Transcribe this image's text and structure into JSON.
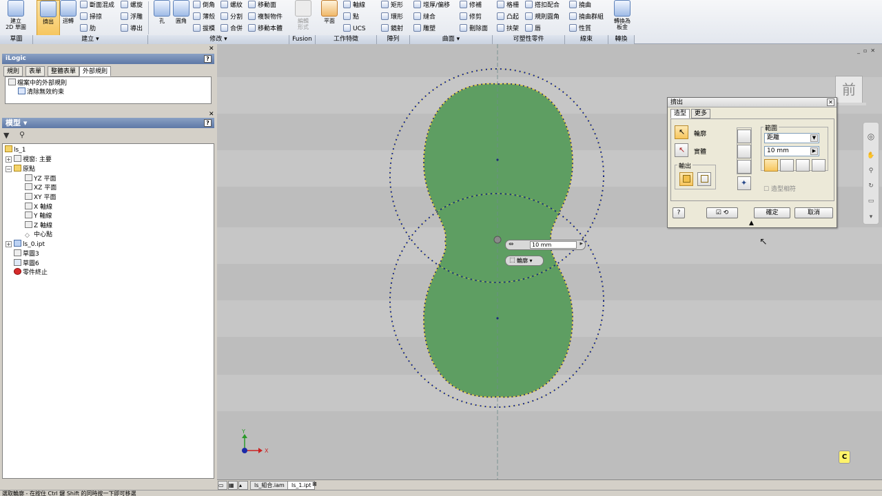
{
  "ribbon": {
    "sketch": {
      "create_2d_sketch": "建立\n2D 草圖",
      "group": "草圖"
    },
    "create": {
      "extrude": "擠出",
      "revolve": "迴轉",
      "loft": "斷面混成",
      "sweep": "掃掠",
      "rib": "肋",
      "coil": "螺旋",
      "emboss": "浮雕",
      "derive": "導出",
      "group": "建立 ▾"
    },
    "modify": {
      "hole": "孔",
      "fillet": "圓角",
      "chamfer": "倒角",
      "shell": "薄殼",
      "draft": "拔模",
      "thread": "螺紋",
      "split": "分割",
      "combine": "合併",
      "move_face": "移動面",
      "copy_object": "複製物件",
      "move_bodies": "移動本體",
      "group": "修改 ▾"
    },
    "fusion": {
      "edit_form": "編輯\n形式",
      "group": "Fusion"
    },
    "work_features": {
      "plane": "平面",
      "axis": "軸線",
      "point": "點",
      "ucs": "UCS",
      "group": "工作特徵"
    },
    "pattern": {
      "rectangular": "矩形",
      "circular": "環形",
      "mirror": "鏡射",
      "group": "陣列"
    },
    "surface": {
      "thicken": "增厚/偏移",
      "stitch": "縫合",
      "sculpt": "雕塑",
      "patch": "修補",
      "trim": "修剪",
      "delete_face": "刪除面",
      "group": "曲面 ▾"
    },
    "plastic_part": {
      "grill": "格柵",
      "boss": "凸起",
      "rest": "扶架",
      "snap_fit": "搭扣配合",
      "rule_fillet": "規則圓角",
      "lip": "唇",
      "group": "可塑性零件"
    },
    "harness": {
      "bend": "撓曲",
      "bend_part": "撓曲群組",
      "property": "性質",
      "group": "線束"
    },
    "convert": {
      "sheet_metal": "轉換為\n板金",
      "group": "轉換"
    }
  },
  "ilogic": {
    "title": "iLogic",
    "help": "?",
    "tabs": [
      "規則",
      "表單",
      "整體表單",
      "外部規則"
    ],
    "active_tab": 3,
    "items": [
      "檔案中的外部規則",
      "清除無效約束"
    ]
  },
  "model": {
    "title": "模型 ▾",
    "help": "?",
    "tree": [
      {
        "label": "ls_1",
        "level": 0
      },
      {
        "label": "視窗: 主要",
        "level": 1
      },
      {
        "label": "原點",
        "level": 1
      },
      {
        "label": "YZ 平面",
        "level": 2
      },
      {
        "label": "XZ 平面",
        "level": 2
      },
      {
        "label": "XY 平面",
        "level": 2
      },
      {
        "label": "X 軸線",
        "level": 2
      },
      {
        "label": "Y 軸線",
        "level": 2
      },
      {
        "label": "Z 軸線",
        "level": 2
      },
      {
        "label": "中心點",
        "level": 2
      },
      {
        "label": "ls_0.ipt",
        "level": 1
      },
      {
        "label": "草圖3",
        "level": 1
      },
      {
        "label": "草圖6",
        "level": 1
      },
      {
        "label": "零件終止",
        "level": 1
      }
    ]
  },
  "viewcube": {
    "face": "前"
  },
  "canvas": {
    "distance_input": "10 mm",
    "profile_menu": "輪廓 ▾",
    "triad_x": "X",
    "triad_y": "Y",
    "c_badge": "C"
  },
  "dialog": {
    "title": "擠出",
    "tabs": [
      "造型",
      "更多"
    ],
    "profile": "輪廓",
    "solid": "實體",
    "output_label": "輸出",
    "extents_label": "範圍",
    "extents_type": "距離",
    "distance": "10 mm",
    "match_shape": "造型相符",
    "ok": "確定",
    "cancel": "取消"
  },
  "doc_tabs": [
    "ls_組合.iam",
    "ls_1.ipt"
  ],
  "status_text": "選取輪廓 - 在按住 Ctrl 鍵 Shift 的同時按一下即可移選"
}
